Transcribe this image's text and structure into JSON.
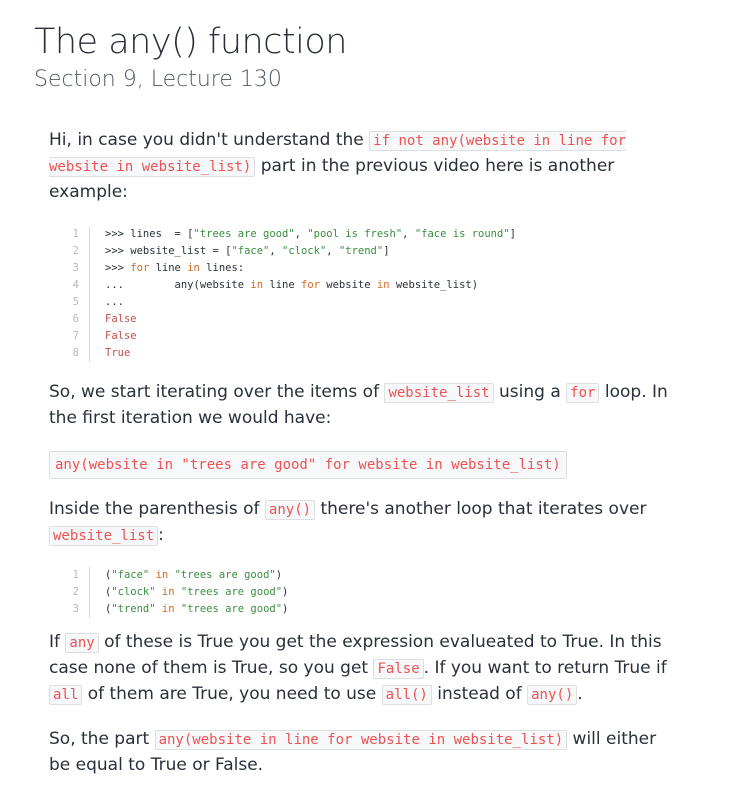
{
  "header": {
    "title": "The any() function",
    "subtitle": "Section 9, Lecture 130"
  },
  "para1": {
    "t1": "Hi, in case you didn't understand the ",
    "c1": "if not any(website in line for website in website_list)",
    "t2": " part in the previous video here is another example:"
  },
  "code1": {
    "line_numbers": [
      "1",
      "2",
      "3",
      "4",
      "5",
      "6",
      "7",
      "8"
    ],
    "l1_a": ">>> lines  = [",
    "l1_s1": "\"trees are good\"",
    "l1_c1": ", ",
    "l1_s2": "\"pool is fresh\"",
    "l1_c2": ", ",
    "l1_s3": "\"face is round\"",
    "l1_e": "]",
    "l2_a": ">>> website_list = [",
    "l2_s1": "\"face\"",
    "l2_c1": ", ",
    "l2_s2": "\"clock\"",
    "l2_c2": ", ",
    "l2_s3": "\"trend\"",
    "l2_e": "]",
    "l3_a": ">>> ",
    "l3_k1": "for",
    "l3_b": " line ",
    "l3_k2": "in",
    "l3_c": " lines:",
    "l4_a": "...        any(website ",
    "l4_k1": "in",
    "l4_b": " line ",
    "l4_k2": "for",
    "l4_c": " website ",
    "l4_k3": "in",
    "l4_d": " website_list)",
    "l5": "...",
    "l6": "False",
    "l7": "False",
    "l8": "True"
  },
  "para2": {
    "t1": "So, we start iterating over the items of ",
    "c1": "website_list",
    "t2": " using a ",
    "c2": "for",
    "t3": " loop. In the first iteration we would have:"
  },
  "wide_code1": "any(website in \"trees are good\" for website in website_list)",
  "para3": {
    "t1": "Inside the parenthesis of ",
    "c1": "any()",
    "t2": " there's another loop that iterates over ",
    "c2": "website_list",
    "t3": ":"
  },
  "code2": {
    "line_numbers": [
      "1",
      "2",
      "3"
    ],
    "l1_a": "(",
    "l1_s1": "\"face\"",
    "l1_k": " in ",
    "l1_s2": "\"trees are good\"",
    "l1_e": ")",
    "l2_a": "(",
    "l2_s1": "\"clock\"",
    "l2_k": " in ",
    "l2_s2": "\"trees are good\"",
    "l2_e": ")",
    "l3_a": "(",
    "l3_s1": "\"trend\"",
    "l3_k": " in ",
    "l3_s2": "\"trees are good\"",
    "l3_e": ")"
  },
  "para4": {
    "t1": "If ",
    "c1": "any",
    "t2": " of these is True you get the expression evalueated to True. In this case none of them is True, so you get ",
    "c2": "False",
    "t3": ". If you want to return True if ",
    "c3": "all",
    "t4": " of them are True, you need to use ",
    "c4": "all()",
    "t5": " instead of ",
    "c5": "any()",
    "t6": "."
  },
  "para5": {
    "t1": "So, the part ",
    "c1": "any(website in line for website in website_list)",
    "t2": " will either be equal to True or False."
  }
}
